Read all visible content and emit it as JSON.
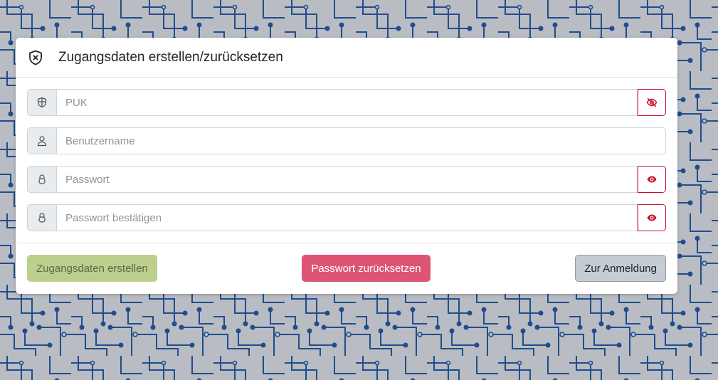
{
  "dialog": {
    "title": "Zugangsdaten erstellen/zurücksetzen",
    "header_icon": "shield-x-icon"
  },
  "fields": {
    "puk": {
      "placeholder": "PUK",
      "value": "",
      "icon": "shield-icon",
      "toggle_icon": "eye-slash-icon"
    },
    "username": {
      "placeholder": "Benutzername",
      "value": "",
      "icon": "person-icon"
    },
    "password": {
      "placeholder": "Passwort",
      "value": "",
      "icon": "lock-icon",
      "toggle_icon": "eye-icon"
    },
    "password_confirm": {
      "placeholder": "Passwort bestätigen",
      "value": "",
      "icon": "lock-icon",
      "toggle_icon": "eye-icon"
    }
  },
  "buttons": {
    "create": "Zugangsdaten erstellen",
    "reset": "Passwort zurücksetzen",
    "login": "Zur Anmeldung"
  },
  "colors": {
    "background": "#b9bcc3",
    "circuit": "#1f4d8c",
    "toggle_accent": "#c8102e",
    "create_button": "#bdcf8c",
    "reset_button": "#de5573",
    "login_button": "#c5ccd3"
  }
}
